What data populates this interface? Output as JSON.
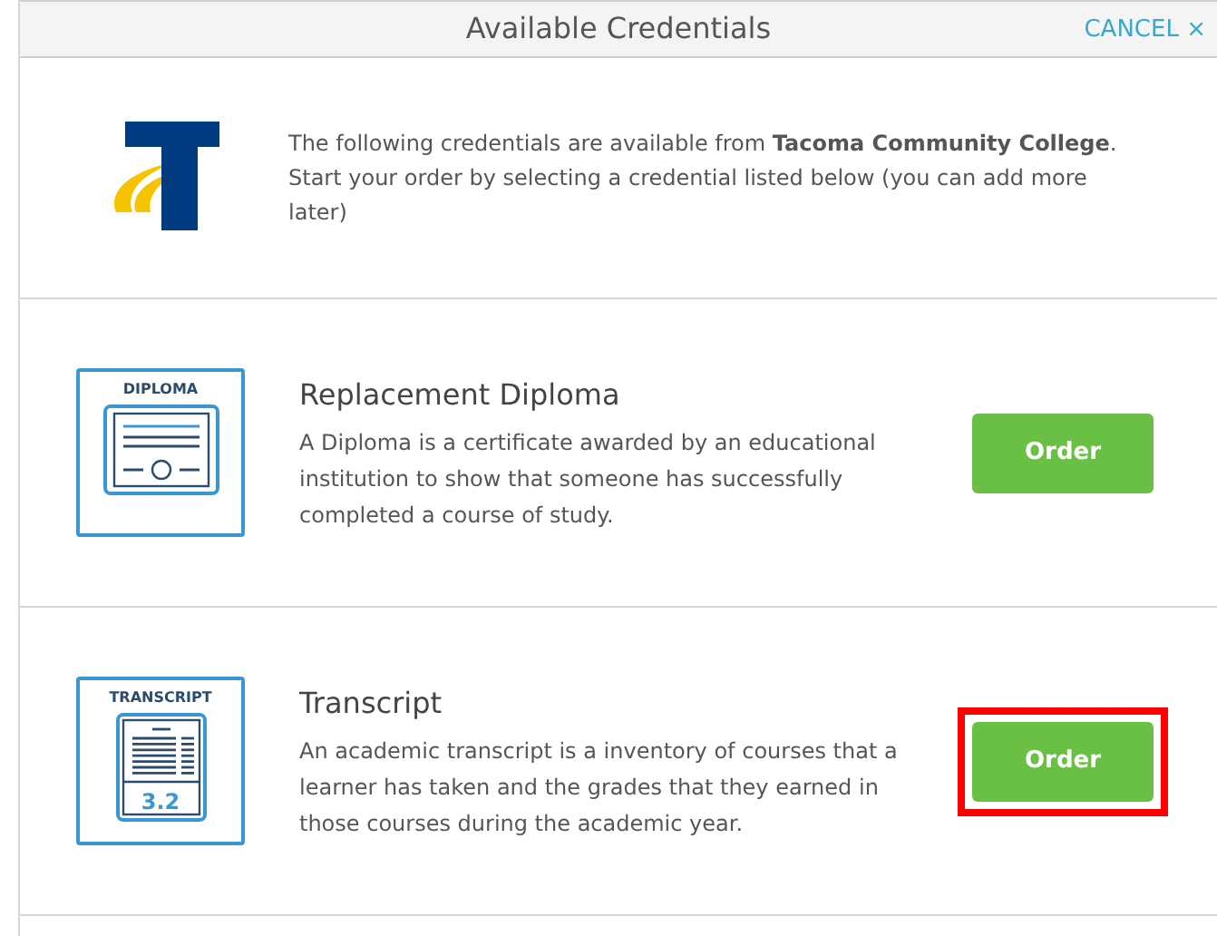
{
  "header": {
    "title": "Available Credentials",
    "cancel": "CANCEL",
    "cancel_icon": "×"
  },
  "intro": {
    "text": "The following credentials are available from **Tacoma Community College**. Start your order by selecting a credential listed below (you can add more later)"
  },
  "credentials": [
    {
      "kind": "diploma",
      "icon_label": "DIPLOMA",
      "title": "Replacement Diploma",
      "description": "A Diploma is a certificate awarded by an educational institution to show that someone has successfully completed a course of study.",
      "button": "Order",
      "highlighted": false
    },
    {
      "kind": "transcript",
      "icon_label": "TRANSCRIPT",
      "icon_value": "3.2",
      "title": "Transcript",
      "description": "An academic transcript is a inventory of courses that a learner has taken and the grades that they earned in those courses during the academic year.",
      "button": "Order",
      "highlighted": true
    }
  ]
}
